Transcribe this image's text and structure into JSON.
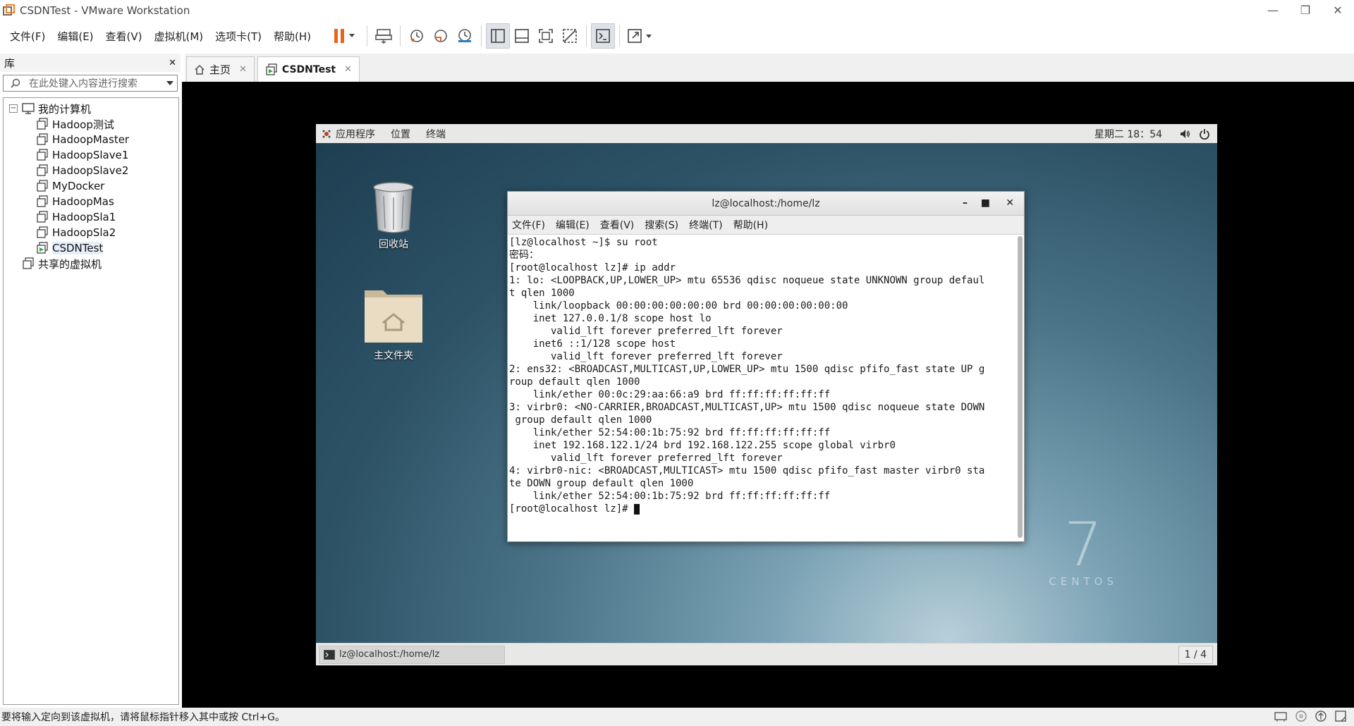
{
  "window": {
    "title": "CSDNTest - VMware Workstation",
    "minimize": "—",
    "restore": "❐",
    "close": "✕"
  },
  "menu": [
    "文件(F)",
    "编辑(E)",
    "查看(V)",
    "虚拟机(M)",
    "选项卡(T)",
    "帮助(H)"
  ],
  "toolbar": {
    "icons": [
      "pause-icon",
      "send-ctrl-alt-del-icon",
      "snapshot-icon",
      "revert-snapshot-icon",
      "snapshot-manager-icon",
      "library-view-icon",
      "thumbnail-view-icon",
      "fullscreen-icon",
      "unity-icon",
      "console-view-icon",
      "stretch-icon"
    ],
    "pause_color": "#e8641b"
  },
  "library": {
    "title": "库",
    "close": "✕",
    "search_placeholder": "在此处键入内容进行搜索",
    "root": "我的计算机",
    "vms": [
      "Hadoop测试",
      "HadoopMaster",
      "HadoopSlave1",
      "HadoopSlave2",
      "MyDocker",
      "HadoopMas",
      "HadoopSla1",
      "HadoopSla2",
      "CSDNTest"
    ],
    "shared": "共享的虚拟机"
  },
  "tabs": [
    {
      "label": "主页",
      "close": "✕"
    },
    {
      "label": "CSDNTest",
      "close": "✕"
    }
  ],
  "guest": {
    "topbar": {
      "apps": "应用程序",
      "places": "位置",
      "terminal": "终端",
      "clock": "星期二 18：54"
    },
    "desktop": {
      "trash": "回收站",
      "home": "主文件夹"
    },
    "terminal_window": {
      "title": "lz@localhost:/home/lz",
      "menu": [
        "文件(F)",
        "编辑(E)",
        "查看(V)",
        "搜索(S)",
        "终端(T)",
        "帮助(H)"
      ],
      "lines": [
        "[lz@localhost ~]$ su root",
        "密码：",
        "[root@localhost lz]# ip addr",
        "1: lo: <LOOPBACK,UP,LOWER_UP> mtu 65536 qdisc noqueue state UNKNOWN group defaul",
        "t qlen 1000",
        "    link/loopback 00:00:00:00:00:00 brd 00:00:00:00:00:00",
        "    inet 127.0.0.1/8 scope host lo",
        "       valid_lft forever preferred_lft forever",
        "    inet6 ::1/128 scope host",
        "       valid_lft forever preferred_lft forever",
        "2: ens32: <BROADCAST,MULTICAST,UP,LOWER_UP> mtu 1500 qdisc pfifo_fast state UP g",
        "roup default qlen 1000",
        "    link/ether 00:0c:29:aa:66:a9 brd ff:ff:ff:ff:ff:ff",
        "3: virbr0: <NO-CARRIER,BROADCAST,MULTICAST,UP> mtu 1500 qdisc noqueue state DOWN",
        " group default qlen 1000",
        "    link/ether 52:54:00:1b:75:92 brd ff:ff:ff:ff:ff:ff",
        "    inet 192.168.122.1/24 brd 192.168.122.255 scope global virbr0",
        "       valid_lft forever preferred_lft forever",
        "4: virbr0-nic: <BROADCAST,MULTICAST> mtu 1500 qdisc pfifo_fast master virbr0 sta",
        "te DOWN group default qlen 1000",
        "    link/ether 52:54:00:1b:75:92 brd ff:ff:ff:ff:ff:ff"
      ],
      "prompt": "[root@localhost lz]# "
    },
    "brand": {
      "number": "7",
      "word": "CENTOS"
    },
    "taskbar": {
      "item": "lz@localhost:/home/lz",
      "workspace": "1 / 4"
    }
  },
  "statusbar": {
    "message": "要将输入定向到该虚拟机，请将鼠标指针移入其中或按 Ctrl+G。"
  }
}
